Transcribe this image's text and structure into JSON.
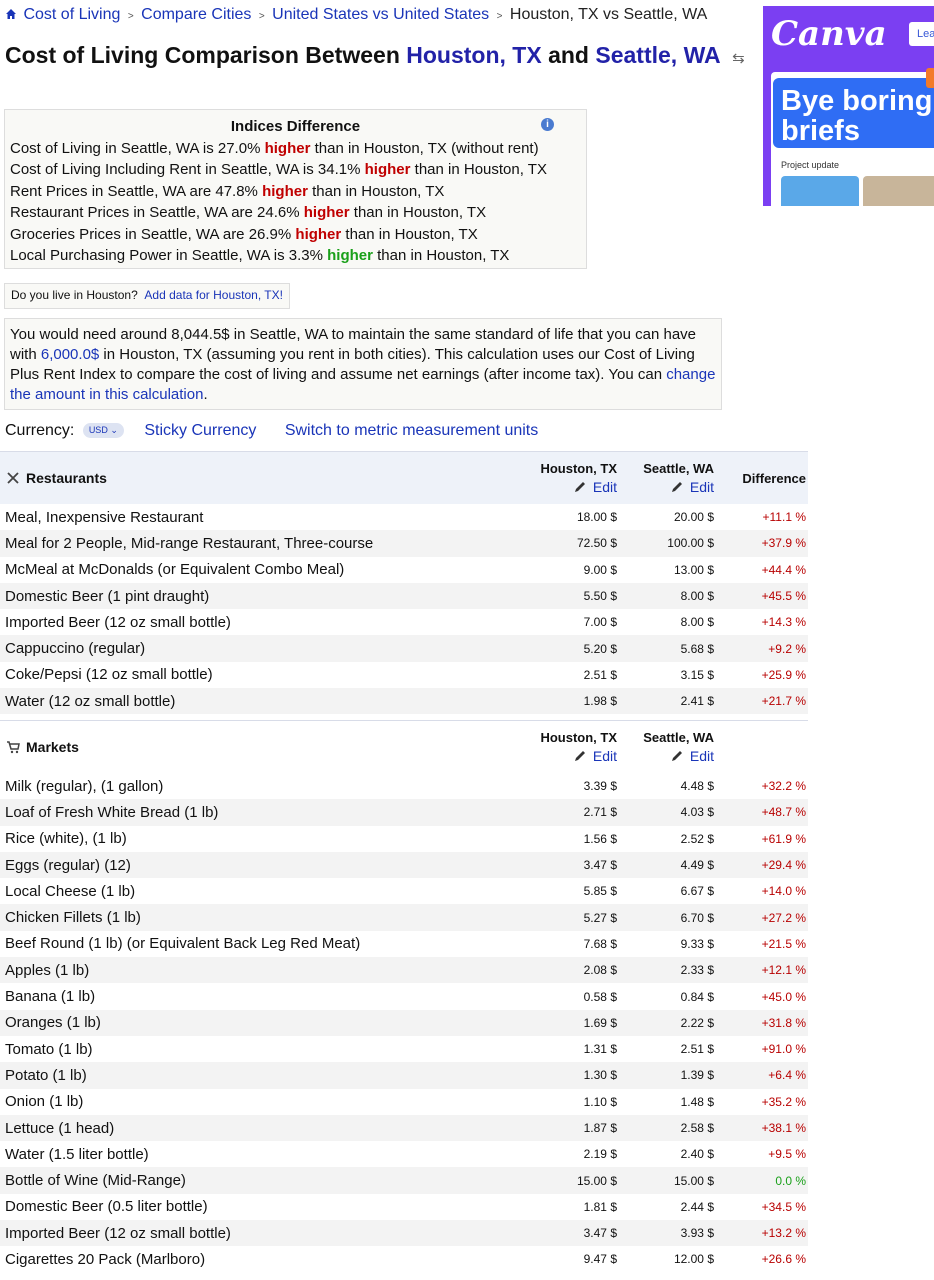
{
  "breadcrumb": {
    "items": [
      "Cost of Living",
      "Compare Cities",
      "United States vs United States",
      "Houston, TX vs Seattle, WA"
    ]
  },
  "title": {
    "prefix": "Cost of Living Comparison Between",
    "city1": "Houston, TX",
    "and": "and",
    "city2": "Seattle, WA"
  },
  "indices": {
    "title": "Indices Difference",
    "rows": [
      {
        "pre": "Cost of Living in Seattle, WA is 27.0%",
        "word": "higher",
        "post": "than in Houston, TX (without rent)",
        "color": "red"
      },
      {
        "pre": "Cost of Living Including Rent in Seattle, WA is 34.1%",
        "word": "higher",
        "post": "than in Houston, TX",
        "color": "red"
      },
      {
        "pre": "Rent Prices in Seattle, WA are 47.8%",
        "word": "higher",
        "post": "than in Houston, TX",
        "color": "red"
      },
      {
        "pre": "Restaurant Prices in Seattle, WA are 24.6%",
        "word": "higher",
        "post": "than in Houston, TX",
        "color": "red"
      },
      {
        "pre": "Groceries Prices in Seattle, WA are 26.9%",
        "word": "higher",
        "post": "than in Houston, TX",
        "color": "red"
      },
      {
        "pre": "Local Purchasing Power in Seattle, WA is 3.3%",
        "word": "higher",
        "post": "than in Houston, TX",
        "color": "green"
      }
    ]
  },
  "live": {
    "question": "Do you live in Houston?",
    "link": "Add data for Houston, TX!"
  },
  "calc": {
    "t1": "You would need around 8,044.5$ in Seattle, WA to maintain the same standard of life that you can have with",
    "amount": "6,000.0$",
    "t2": "in Houston, TX (assuming you rent in both cities). This calculation uses our Cost of Living Plus Rent Index to compare the cost of living and assume net earnings (after income tax). You can",
    "link": "change the amount in this calculation",
    "t3": "."
  },
  "currency": {
    "label": "Currency:",
    "value": "USD",
    "sticky": "Sticky Currency",
    "metric": "Switch to metric measurement units"
  },
  "columns": {
    "city1": "Houston, TX",
    "city2": "Seattle, WA",
    "edit": "Edit",
    "difference": "Difference"
  },
  "restaurants": {
    "title": "Restaurants",
    "rows": [
      {
        "name": "Meal, Inexpensive Restaurant",
        "v1": "18.00 $",
        "v2": "20.00 $",
        "diff": "+11.1 %"
      },
      {
        "name": "Meal for 2 People, Mid-range Restaurant, Three-course",
        "v1": "72.50 $",
        "v2": "100.00 $",
        "diff": "+37.9 %"
      },
      {
        "name": "McMeal at McDonalds (or Equivalent Combo Meal)",
        "v1": "9.00 $",
        "v2": "13.00 $",
        "diff": "+44.4 %"
      },
      {
        "name": "Domestic Beer (1 pint draught)",
        "v1": "5.50 $",
        "v2": "8.00 $",
        "diff": "+45.5 %"
      },
      {
        "name": "Imported Beer (12 oz small bottle)",
        "v1": "7.00 $",
        "v2": "8.00 $",
        "diff": "+14.3 %"
      },
      {
        "name": "Cappuccino (regular)",
        "v1": "5.20 $",
        "v2": "5.68 $",
        "diff": "+9.2 %"
      },
      {
        "name": "Coke/Pepsi (12 oz small bottle)",
        "v1": "2.51 $",
        "v2": "3.15 $",
        "diff": "+25.9 %"
      },
      {
        "name": "Water (12 oz small bottle)",
        "v1": "1.98 $",
        "v2": "2.41 $",
        "diff": "+21.7 %"
      }
    ]
  },
  "markets": {
    "title": "Markets",
    "rows": [
      {
        "name": "Milk (regular), (1 gallon)",
        "v1": "3.39 $",
        "v2": "4.48 $",
        "diff": "+32.2 %"
      },
      {
        "name": "Loaf of Fresh White Bread (1 lb)",
        "v1": "2.71 $",
        "v2": "4.03 $",
        "diff": "+48.7 %"
      },
      {
        "name": "Rice (white), (1 lb)",
        "v1": "1.56 $",
        "v2": "2.52 $",
        "diff": "+61.9 %"
      },
      {
        "name": "Eggs (regular) (12)",
        "v1": "3.47 $",
        "v2": "4.49 $",
        "diff": "+29.4 %"
      },
      {
        "name": "Local Cheese (1 lb)",
        "v1": "5.85 $",
        "v2": "6.67 $",
        "diff": "+14.0 %"
      },
      {
        "name": "Chicken Fillets (1 lb)",
        "v1": "5.27 $",
        "v2": "6.70 $",
        "diff": "+27.2 %"
      },
      {
        "name": "Beef Round (1 lb) (or Equivalent Back Leg Red Meat)",
        "v1": "7.68 $",
        "v2": "9.33 $",
        "diff": "+21.5 %"
      },
      {
        "name": "Apples (1 lb)",
        "v1": "2.08 $",
        "v2": "2.33 $",
        "diff": "+12.1 %"
      },
      {
        "name": "Banana (1 lb)",
        "v1": "0.58 $",
        "v2": "0.84 $",
        "diff": "+45.0 %"
      },
      {
        "name": "Oranges (1 lb)",
        "v1": "1.69 $",
        "v2": "2.22 $",
        "diff": "+31.8 %"
      },
      {
        "name": "Tomato (1 lb)",
        "v1": "1.31 $",
        "v2": "2.51 $",
        "diff": "+91.0 %"
      },
      {
        "name": "Potato (1 lb)",
        "v1": "1.30 $",
        "v2": "1.39 $",
        "diff": "+6.4 %"
      },
      {
        "name": "Onion (1 lb)",
        "v1": "1.10 $",
        "v2": "1.48 $",
        "diff": "+35.2 %"
      },
      {
        "name": "Lettuce (1 head)",
        "v1": "1.87 $",
        "v2": "2.58 $",
        "diff": "+38.1 %"
      },
      {
        "name": "Water (1.5 liter bottle)",
        "v1": "2.19 $",
        "v2": "2.40 $",
        "diff": "+9.5 %"
      },
      {
        "name": "Bottle of Wine (Mid-Range)",
        "v1": "15.00 $",
        "v2": "15.00 $",
        "diff": "0.0 %"
      },
      {
        "name": "Domestic Beer (0.5 liter bottle)",
        "v1": "1.81 $",
        "v2": "2.44 $",
        "diff": "+34.5 %"
      },
      {
        "name": "Imported Beer (12 oz small bottle)",
        "v1": "3.47 $",
        "v2": "3.93 $",
        "diff": "+13.2 %"
      },
      {
        "name": "Cigarettes 20 Pack (Marlboro)",
        "v1": "9.47 $",
        "v2": "12.00 $",
        "diff": "+26.6 %"
      }
    ]
  },
  "ad": {
    "brand": "Canva",
    "button": "Lea",
    "headline": "Bye boring briefs",
    "caption": "Project update"
  },
  "colors": {
    "link": "#1a35b8",
    "higher_red": "#c00000",
    "higher_green": "#1aa01a",
    "diff_red": "#b80000"
  }
}
